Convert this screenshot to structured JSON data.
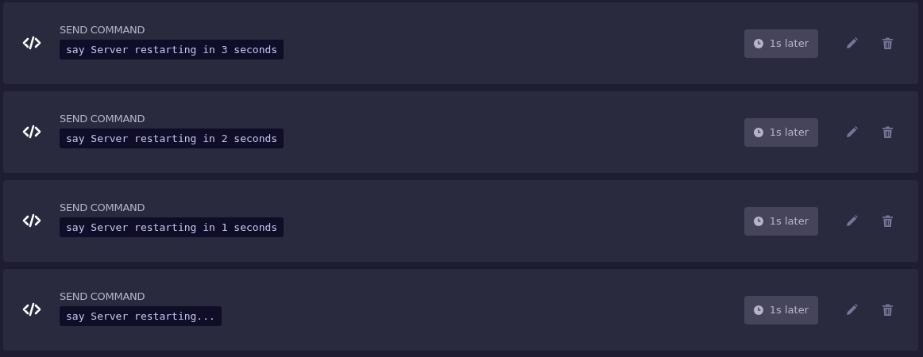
{
  "tasks": [
    {
      "label": "SEND COMMAND",
      "command": "say Server restarting in 3 seconds",
      "delay": "1s later"
    },
    {
      "label": "SEND COMMAND",
      "command": "say Server restarting in 2 seconds",
      "delay": "1s later"
    },
    {
      "label": "SEND COMMAND",
      "command": "say Server restarting in 1 seconds",
      "delay": "1s later"
    },
    {
      "label": "SEND COMMAND",
      "command": "say Server restarting...",
      "delay": "1s later"
    }
  ]
}
